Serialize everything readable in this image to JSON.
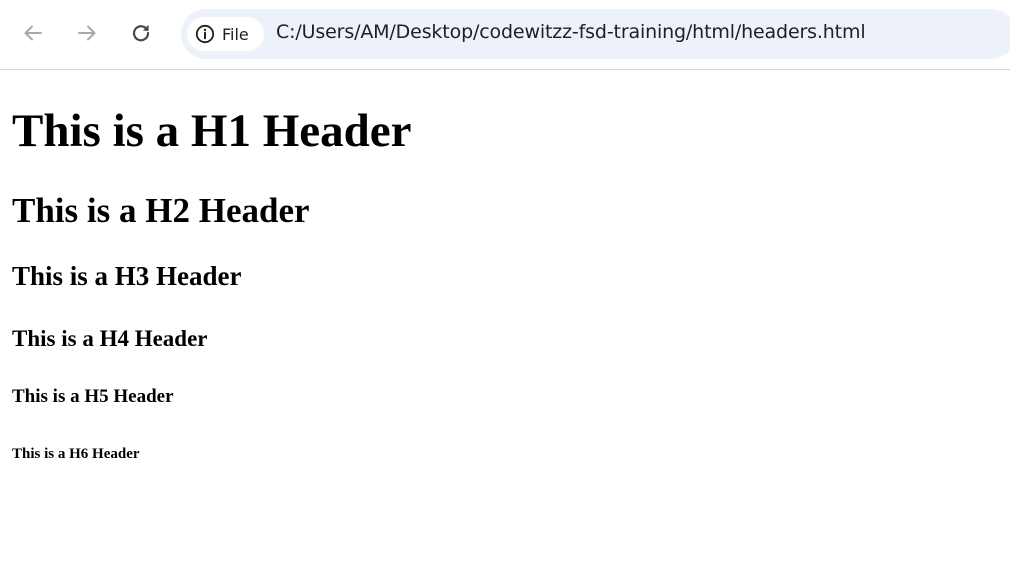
{
  "browser": {
    "site_info_label": "File",
    "url": "C:/Users/AM/Desktop/codewitzz-fsd-training/html/headers.html",
    "icons": {
      "back": "arrow-left",
      "forward": "arrow-right",
      "reload": "reload",
      "site_info": "info-circle"
    },
    "colors": {
      "omnibox_bg": "#edf2fa",
      "chip_bg": "#ffffff",
      "icon_active": "#474747",
      "icon_disabled": "#a8a8a8"
    }
  },
  "page": {
    "h1": "This is a H1 Header",
    "h2": "This is a H2 Header",
    "h3": "This is a H3 Header",
    "h4": "This is a H4 Header",
    "h5": "This is a H5 Header",
    "h6": "This is a H6 Header"
  }
}
